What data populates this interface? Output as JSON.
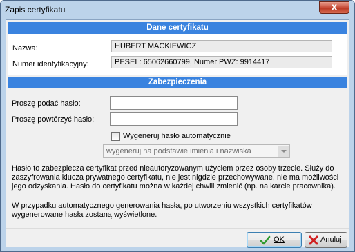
{
  "window": {
    "title": "Zapis certyfikatu",
    "close_label": "x"
  },
  "certificate_section": {
    "header": "Dane certyfikatu",
    "name_label": "Nazwa:",
    "name_value": "HUBERT MACKIEWICZ",
    "id_label": "Numer identyfikacyjny:",
    "id_value": "PESEL: 65062660799, Numer PWZ: 9914417"
  },
  "security_section": {
    "header": "Zabezpieczenia",
    "password_label": "Proszę podać hasło:",
    "password_value": "",
    "repeat_label": "Proszę powtórzyć hasło:",
    "repeat_value": "",
    "auto_checkbox_label": "Wygeneruj hasło automatycznie",
    "auto_checked": false,
    "generation_select_value": "wygeneruj na podstawie imienia i nazwiska"
  },
  "info": {
    "paragraph1": "Hasło to zabezpiecza certyfikat przed nieautoryzowanym użyciem przez osoby trzecie. Służy do zaszyfrowania klucza prywatnego certyfikatu, nie jest nigdzie przechowywane, nie ma możliwości jego odzyskania. Hasło do certyfikatu można w każdej chwili zmienić (np. na karcie pracownika).",
    "paragraph2": "W przypadku automatycznego generowania hasła, po utworzeniu wszystkich certyfikatów wygenerowane hasła zostaną wyświetlone."
  },
  "buttons": {
    "ok_label": "OK",
    "cancel_label": "Anuluj"
  },
  "icons": {
    "ok": "checkmark-icon",
    "cancel": "red-x-icon",
    "close": "close-icon"
  },
  "colors": {
    "section_header": "#3a83df",
    "window_frame": "#bcd3ea",
    "close_button": "#c74a36"
  }
}
